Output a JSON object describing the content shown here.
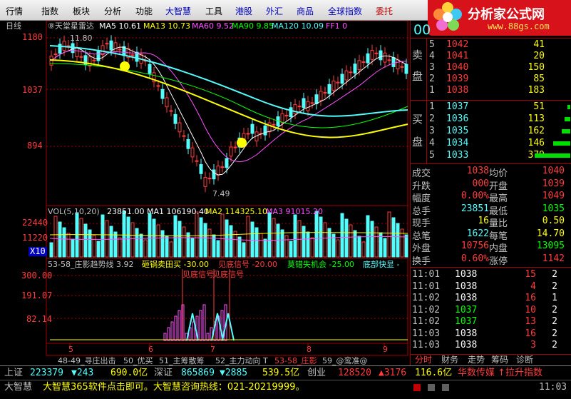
{
  "menu": [
    "行情",
    "指数",
    "板块",
    "分析",
    "功能",
    "大智慧",
    "工具",
    "港股",
    "外汇",
    "商品",
    "全球指数",
    "委托"
  ],
  "logo": {
    "title": "分析家公式网",
    "url": "www.88gs.com"
  },
  "period_label": "日线",
  "indicator_line": {
    "name": "⑧天堂星雷达",
    "ma5": "MA5 10.61",
    "ma13": "MA13 10.73",
    "ma60": "MA60 9.52",
    "ma90": "MA90 9.85",
    "ma120": "MA120 10.09",
    "ff": "FF1 0"
  },
  "price_axis": [
    "1180",
    "1037",
    "894"
  ],
  "price_marks": {
    "high": "11.80",
    "low": "7.49"
  },
  "volume_line": {
    "name": "VOL(5,10,20)",
    "v": "23851.00",
    "ma1": "MA1 106190.40",
    "ma2": "MA2 114325.10",
    "ma3": "MA3 91015.20"
  },
  "volume_axis": [
    "22440",
    "11220",
    "X10"
  ],
  "ind2_line": {
    "name": "53-58_庄影趋势线 3.92",
    "a": "砸锅卖田买 -30.00",
    "b": "见底信号 -20.00",
    "c": "莫错失机会 -25.00",
    "d": "底部快显 -"
  },
  "ind2_axis": [
    "300.00",
    "191.07",
    "82.14"
  ],
  "ind2_labels": "见底信号",
  "date_ticks": [
    "5",
    "6",
    "7",
    "8",
    "9"
  ],
  "bottom_tabs": [
    "48-49_寻庄出击",
    "50_优买",
    "51_主筹散筹",
    "52_主力动向 T",
    "53-58_庄影",
    "59_@鸾准@"
  ],
  "quote": {
    "code": "00",
    "sell_label": [
      "卖",
      "盘"
    ],
    "buy_label": [
      "买",
      "盘"
    ],
    "sell": [
      {
        "n": "5",
        "p": "1042",
        "v": "41"
      },
      {
        "n": "4",
        "p": "1041",
        "v": "20"
      },
      {
        "n": "3",
        "p": "1040",
        "v": "150"
      },
      {
        "n": "2",
        "p": "1039",
        "v": "85"
      },
      {
        "n": "1",
        "p": "1038",
        "v": "183"
      }
    ],
    "buy": [
      {
        "n": "1",
        "p": "1037",
        "v": "51"
      },
      {
        "n": "2",
        "p": "1036",
        "v": "113"
      },
      {
        "n": "3",
        "p": "1035",
        "v": "162"
      },
      {
        "n": "4",
        "p": "1034",
        "v": "146"
      },
      {
        "n": "5",
        "p": "1033",
        "v": "379"
      }
    ],
    "stats": [
      {
        "l1": "成交",
        "v1": "1038",
        "l2": "均价",
        "v2": "1040"
      },
      {
        "l1": "升跌",
        "v1": "000",
        "l2": "开盘",
        "v2": "1039"
      },
      {
        "l1": "幅度",
        "v1": "0.00%",
        "l2": "最高",
        "v2": "1049"
      },
      {
        "l1": "总手",
        "v1": "23851",
        "l2": "最低",
        "v2": "1035"
      },
      {
        "l1": "现手",
        "v1": "16",
        "l2": "量比",
        "v2": "0.50"
      },
      {
        "l1": "总笔",
        "v1": "1622",
        "l2": "每笔",
        "v2": "14.70"
      },
      {
        "l1": "外盘",
        "v1": "10756",
        "l2": "内盘",
        "v2": "13095"
      },
      {
        "l1": "换手",
        "v1": "0.60%",
        "l2": "涨停",
        "v2": "1142"
      }
    ],
    "ticks": [
      {
        "t": "11:01",
        "p": "1038",
        "v": "15",
        "n": "2"
      },
      {
        "t": "11:01",
        "p": "1038",
        "v": "4",
        "n": "2"
      },
      {
        "t": "11:02",
        "p": "1038",
        "v": "16",
        "n": "1"
      },
      {
        "t": "11:02",
        "p": "1037",
        "v": "10",
        "n": "2"
      },
      {
        "t": "11:02",
        "p": "1037",
        "v": "13",
        "n": "2"
      },
      {
        "t": "11:03",
        "p": "1038",
        "v": "16",
        "n": "2"
      },
      {
        "t": "11:03",
        "p": "1038",
        "v": "3",
        "n": "2"
      }
    ],
    "tabs": [
      "分时",
      "财务",
      "走势",
      "筹码",
      "诊断"
    ]
  },
  "status": {
    "r1": {
      "sh_label": "上证",
      "sh_idx": "223379",
      "sh_chg": "▼243",
      "sh_amt": "690.0亿",
      "sz_label": "深证",
      "sz_idx": "865869",
      "sz_chg": "▼2885",
      "sz_amt": "539.5亿",
      "cy_label": "创业",
      "cy_idx": "128520",
      "cy_chg": "▲3176",
      "cy_amt": "116.6亿",
      "news": "华数传媒 ↑拉升指数"
    },
    "r2": {
      "brand": "大智慧",
      "ticker": "大智慧365软件点击即可。大智慧咨询热线：021-20219999。",
      "time": "11:03"
    }
  },
  "colors": {
    "up": "#ff3c3c",
    "down": "#54fcfc",
    "bg": "#000000",
    "grid": "#a00000"
  }
}
